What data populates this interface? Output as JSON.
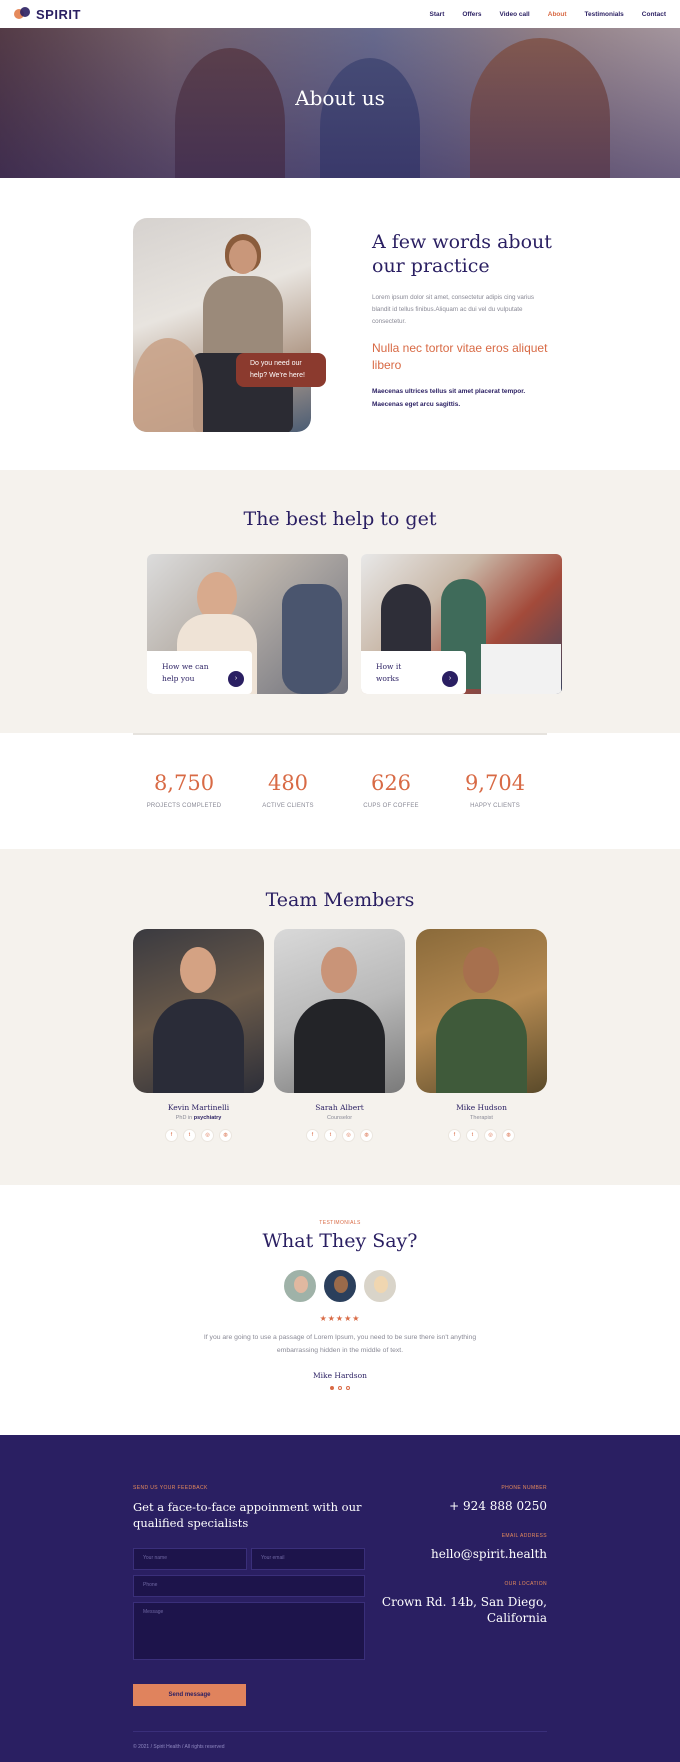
{
  "header": {
    "brand": "SPIRIT",
    "nav": [
      "Start",
      "Offers",
      "Video call",
      "About",
      "Testimonials",
      "Contact"
    ],
    "active_nav": "About"
  },
  "hero": {
    "title": "About us"
  },
  "about": {
    "heading": "A few words about our practice",
    "lorem": "Lorem ipsum dolor sit amet, consectetur adipis cing varius blandit id tellus finibus.Aliquam ac dui vel du vulputate consectetur.",
    "accent": "Nulla nec tortor vitae eros aliquet libero",
    "bold": "Maecenas ultrices tellus sit amet placerat tempor. Maecenas eget arcu sagittis.",
    "bubble": "Do you need our help? We're here!"
  },
  "best_help": {
    "heading": "The best help to get",
    "cards": [
      {
        "label": "How we can help you",
        "arrow": "›"
      },
      {
        "label": "How it works",
        "arrow": "›"
      }
    ]
  },
  "stats": [
    {
      "value": "8,750",
      "label": "PROJECTS COMPLETED"
    },
    {
      "value": "480",
      "label": "ACTIVE CLIENTS"
    },
    {
      "value": "626",
      "label": "CUPS OF COFFEE"
    },
    {
      "value": "9,704",
      "label": "HAPPY CLIENTS"
    }
  ],
  "team": {
    "heading": "Team Members",
    "members": [
      {
        "name": "Kevin Martinelli",
        "role_prefix": "PhD in ",
        "role_bold": "psychiatry"
      },
      {
        "name": "Sarah Albert",
        "role_prefix": "Counselor",
        "role_bold": ""
      },
      {
        "name": "Mike Hudson",
        "role_prefix": "Therapist",
        "role_bold": ""
      }
    ],
    "social_icons": [
      "facebook-icon",
      "twitter-icon",
      "instagram-icon",
      "dribbble-icon"
    ],
    "social_glyphs": [
      "f",
      "t",
      "◎",
      "◍"
    ]
  },
  "testimonials": {
    "kicker": "TESTIMONIALS",
    "heading": "What They Say?",
    "stars": "★★★★★",
    "quote": "If you are going to use a passage of Lorem Ipsum, you need to be sure there isn't anything embarrassing hidden in the middle of text.",
    "author": "Mike Hardson"
  },
  "footer": {
    "feedback_kicker": "SEND US YOUR FEEDBACK",
    "feedback_heading": "Get a face-to-face appoinment with our qualified specialists",
    "name_placeholder": "Your name",
    "email_placeholder": "Your email",
    "phone_placeholder": "Phone",
    "message_placeholder": "Message",
    "send_label": "Send message",
    "phone_kicker": "PHONE NUMBER",
    "phone": "+ 924 888 0250",
    "email_kicker": "EMAIL ADDRESS",
    "email": "hello@spirit.health",
    "location_kicker": "OUR LOCATION",
    "location": "Crown Rd. 14b, San Diego, California",
    "copyright": "© 2021 / Spirit Health / All rights reserved"
  },
  "colors": {
    "primary": "#2a1f62",
    "accent": "#d86a45",
    "beige": "#f5f2ed"
  }
}
